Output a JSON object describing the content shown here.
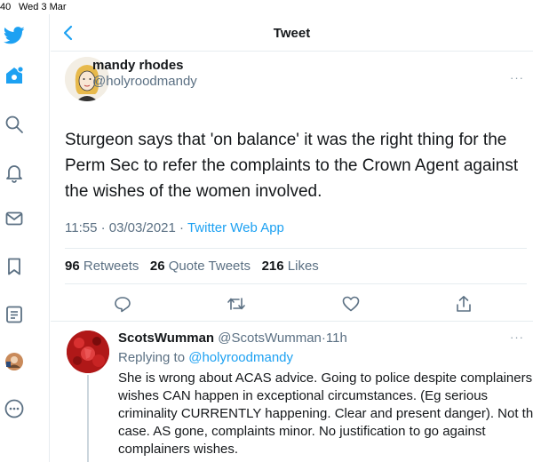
{
  "status_bar": {
    "time": "40",
    "date": "Wed 3 Mar"
  },
  "header": {
    "title": "Tweet"
  },
  "tweet": {
    "author_name": "mandy rhodes",
    "author_handle": "@holyroodmandy",
    "text_lines": [
      "Sturgeon says that 'on balance' it was the right thing for the",
      "Perm Sec to refer the complaints to the Crown Agent against",
      "the wishes of the women involved."
    ],
    "time": "11:55",
    "date": "03/03/2021",
    "separator": "·",
    "source": "Twitter Web App",
    "retweets_count": "96",
    "retweets_label": "Retweets",
    "quotes_count": "26",
    "quotes_label": "Quote Tweets",
    "likes_count": "216",
    "likes_label": "Likes"
  },
  "reply": {
    "author_name": "ScotsWumman",
    "author_handle": "@ScotsWumman",
    "separator": "·",
    "time": "11h",
    "replying_prefix": "Replying to",
    "replying_to": "@holyroodmandy",
    "text_lines": [
      "She is wrong about ACAS advice. Going to police despite complainers",
      "wishes CAN happen in exceptional circumstances. (Eg serious",
      "criminality CURRENTLY happening. Clear and present danger). Not this",
      "case. AS gone, complaints minor. No justification to go against",
      "complainers wishes."
    ]
  },
  "more_label": "···",
  "sidebar_icons": [
    "twitter-logo-icon",
    "home-icon",
    "search-icon",
    "bell-icon",
    "mail-icon",
    "bookmark-icon",
    "list-icon",
    "profile-avatar",
    "more-icon"
  ],
  "colors": {
    "brand": "#1da1f2",
    "text": "#14171a",
    "secondary": "#5b7083",
    "border": "#e6ecf0"
  }
}
